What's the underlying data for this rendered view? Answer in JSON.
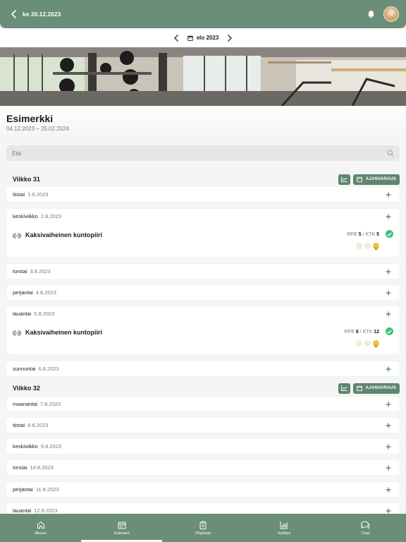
{
  "header": {
    "title": "ke 20.12.2023",
    "icons": [
      "back-arrow-icon",
      "bell-icon",
      "avatar"
    ]
  },
  "month_nav": {
    "label": "elo 2023"
  },
  "program": {
    "title": "Esimerkki",
    "dates": "04.12.2023 – 25.02.2024"
  },
  "search": {
    "placeholder": "Etsi"
  },
  "weeks": [
    {
      "label": "Viikko 31",
      "booking_label": "AJANVARAUS"
    },
    {
      "label": "Viikko 32",
      "booking_label": "AJANVARAUS"
    }
  ],
  "days": [
    {
      "name": "tiistai",
      "date": "1.8.2023"
    },
    {
      "name": "keskiviikko",
      "date": "2.8.2023",
      "workout": {
        "title": "Kaksivaiheinen kuntopiiri",
        "rpe_label": "RPE",
        "rpe": "5",
        "sep": " / ",
        "ktk_label": "KTK",
        "ktk": "5",
        "rating": 3
      }
    },
    {
      "name": "torstai",
      "date": "3.8.2023"
    },
    {
      "name": "perjantai",
      "date": "4.8.2023"
    },
    {
      "name": "lauantai",
      "date": "5.8.2023",
      "workout": {
        "title": "Kaksivaiheinen kuntopiiri",
        "rpe_label": "RPE",
        "rpe": "6",
        "sep": " / ",
        "ktk_label": "KTK",
        "ktk": "12",
        "rating": 3
      }
    },
    {
      "name": "sunnuntai",
      "date": "6.8.2023"
    },
    {
      "name": "maanantai",
      "date": "7.8.2023"
    },
    {
      "name": "tiistai",
      "date": "8.8.2023"
    },
    {
      "name": "keskiviikko",
      "date": "9.8.2023"
    },
    {
      "name": "torstai",
      "date": "10.8.2023"
    },
    {
      "name": "perjantai",
      "date": "11.8.2023"
    },
    {
      "name": "lauantai",
      "date": "12.8.2023"
    }
  ],
  "bottom_nav": [
    {
      "label": "Alkuun",
      "icon": "home-icon"
    },
    {
      "label": "Kalenteri",
      "icon": "calendar-icon",
      "active": true
    },
    {
      "label": "Ohjelmat",
      "icon": "clipboard-icon"
    },
    {
      "label": "Kehitys",
      "icon": "bar-chart-icon"
    },
    {
      "label": "Chat",
      "icon": "chat-icon"
    }
  ],
  "colors": {
    "brand": "#6a8e78",
    "chip": "#5e8670",
    "success": "#3fc07a",
    "background": "#f4f4f3"
  }
}
